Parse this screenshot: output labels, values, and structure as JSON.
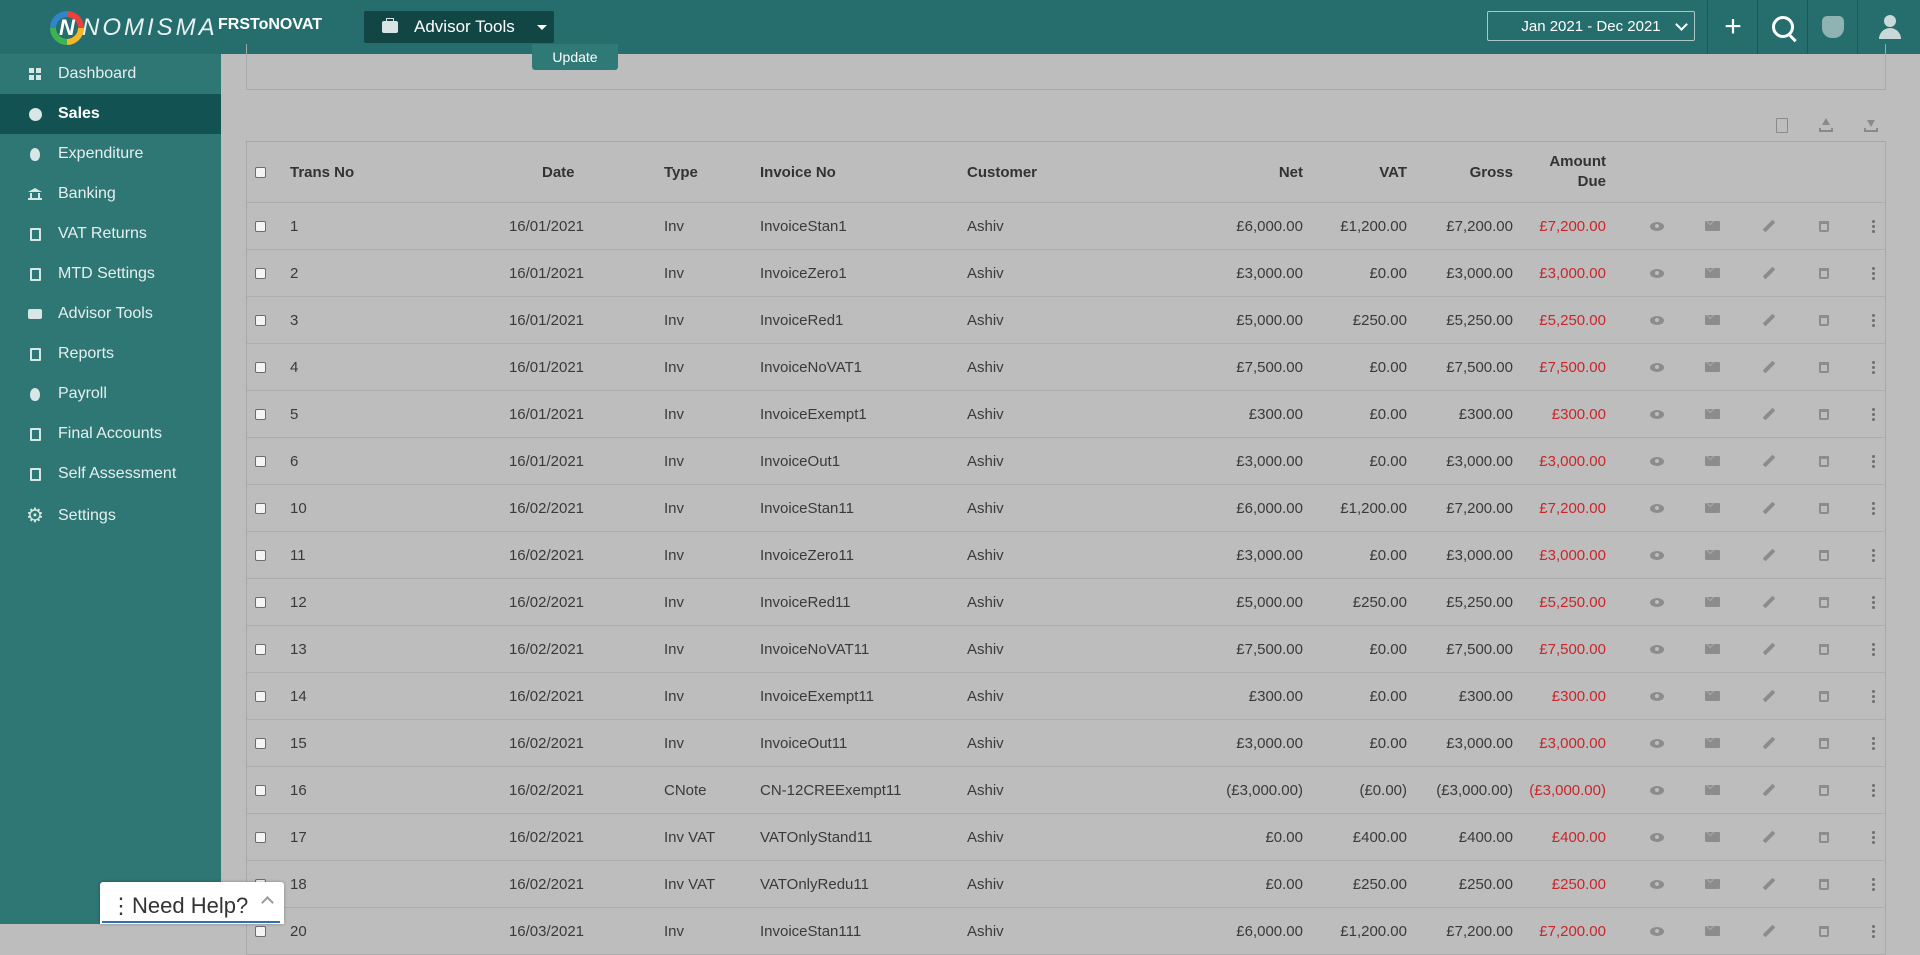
{
  "app": {
    "logo_text": "NOMISMA",
    "company": "FRSToNOVAT",
    "advisor_tools_label": "Advisor Tools",
    "period": "Jan 2021 - Dec 2021"
  },
  "sidebar": {
    "items": [
      {
        "label": "Dashboard",
        "icon": "dashboard-icon",
        "active": false
      },
      {
        "label": "Sales",
        "icon": "sales-icon",
        "active": true
      },
      {
        "label": "Expenditure",
        "icon": "expenditure-icon",
        "active": false
      },
      {
        "label": "Banking",
        "icon": "bank-icon",
        "active": false
      },
      {
        "label": "VAT Returns",
        "icon": "vat-returns-icon",
        "active": false
      },
      {
        "label": "MTD Settings",
        "icon": "mtd-settings-icon",
        "active": false
      },
      {
        "label": "Advisor Tools",
        "icon": "briefcase-icon",
        "active": false
      },
      {
        "label": "Reports",
        "icon": "reports-icon",
        "active": false
      },
      {
        "label": "Payroll",
        "icon": "payroll-icon",
        "active": false
      },
      {
        "label": "Final Accounts",
        "icon": "final-accounts-icon",
        "active": false
      },
      {
        "label": "Self Assessment",
        "icon": "self-assessment-icon",
        "active": false
      },
      {
        "label": "Settings",
        "icon": "gear-icon",
        "active": false
      }
    ]
  },
  "filter": {
    "update_label": "Update"
  },
  "table": {
    "headers": {
      "trans_no": "Trans No",
      "date": "Date",
      "type": "Type",
      "invoice_no": "Invoice No",
      "customer": "Customer",
      "net": "Net",
      "vat": "VAT",
      "gross": "Gross",
      "amount_due_line1": "Amount",
      "amount_due_line2": "Due"
    },
    "rows": [
      {
        "trans_no": "1",
        "date": "16/01/2021",
        "type": "Inv",
        "invoice_no": "InvoiceStan1",
        "customer": "Ashiv",
        "net": "£6,000.00",
        "vat": "£1,200.00",
        "gross": "£7,200.00",
        "due": "£7,200.00"
      },
      {
        "trans_no": "2",
        "date": "16/01/2021",
        "type": "Inv",
        "invoice_no": "InvoiceZero1",
        "customer": "Ashiv",
        "net": "£3,000.00",
        "vat": "£0.00",
        "gross": "£3,000.00",
        "due": "£3,000.00"
      },
      {
        "trans_no": "3",
        "date": "16/01/2021",
        "type": "Inv",
        "invoice_no": "InvoiceRed1",
        "customer": "Ashiv",
        "net": "£5,000.00",
        "vat": "£250.00",
        "gross": "£5,250.00",
        "due": "£5,250.00"
      },
      {
        "trans_no": "4",
        "date": "16/01/2021",
        "type": "Inv",
        "invoice_no": "InvoiceNoVAT1",
        "customer": "Ashiv",
        "net": "£7,500.00",
        "vat": "£0.00",
        "gross": "£7,500.00",
        "due": "£7,500.00"
      },
      {
        "trans_no": "5",
        "date": "16/01/2021",
        "type": "Inv",
        "invoice_no": "InvoiceExempt1",
        "customer": "Ashiv",
        "net": "£300.00",
        "vat": "£0.00",
        "gross": "£300.00",
        "due": "£300.00"
      },
      {
        "trans_no": "6",
        "date": "16/01/2021",
        "type": "Inv",
        "invoice_no": "InvoiceOut1",
        "customer": "Ashiv",
        "net": "£3,000.00",
        "vat": "£0.00",
        "gross": "£3,000.00",
        "due": "£3,000.00"
      },
      {
        "trans_no": "10",
        "date": "16/02/2021",
        "type": "Inv",
        "invoice_no": "InvoiceStan11",
        "customer": "Ashiv",
        "net": "£6,000.00",
        "vat": "£1,200.00",
        "gross": "£7,200.00",
        "due": "£7,200.00"
      },
      {
        "trans_no": "11",
        "date": "16/02/2021",
        "type": "Inv",
        "invoice_no": "InvoiceZero11",
        "customer": "Ashiv",
        "net": "£3,000.00",
        "vat": "£0.00",
        "gross": "£3,000.00",
        "due": "£3,000.00"
      },
      {
        "trans_no": "12",
        "date": "16/02/2021",
        "type": "Inv",
        "invoice_no": "InvoiceRed11",
        "customer": "Ashiv",
        "net": "£5,000.00",
        "vat": "£250.00",
        "gross": "£5,250.00",
        "due": "£5,250.00"
      },
      {
        "trans_no": "13",
        "date": "16/02/2021",
        "type": "Inv",
        "invoice_no": "InvoiceNoVAT11",
        "customer": "Ashiv",
        "net": "£7,500.00",
        "vat": "£0.00",
        "gross": "£7,500.00",
        "due": "£7,500.00"
      },
      {
        "trans_no": "14",
        "date": "16/02/2021",
        "type": "Inv",
        "invoice_no": "InvoiceExempt11",
        "customer": "Ashiv",
        "net": "£300.00",
        "vat": "£0.00",
        "gross": "£300.00",
        "due": "£300.00"
      },
      {
        "trans_no": "15",
        "date": "16/02/2021",
        "type": "Inv",
        "invoice_no": "InvoiceOut11",
        "customer": "Ashiv",
        "net": "£3,000.00",
        "vat": "£0.00",
        "gross": "£3,000.00",
        "due": "£3,000.00"
      },
      {
        "trans_no": "16",
        "date": "16/02/2021",
        "type": "CNote",
        "invoice_no": "CN-12CREExempt11",
        "customer": "Ashiv",
        "net": "(£3,000.00)",
        "vat": "(£0.00)",
        "gross": "(£3,000.00)",
        "due": "(£3,000.00)"
      },
      {
        "trans_no": "17",
        "date": "16/02/2021",
        "type": "Inv VAT",
        "invoice_no": "VATOnlyStand11",
        "customer": "Ashiv",
        "net": "£0.00",
        "vat": "£400.00",
        "gross": "£400.00",
        "due": "£400.00"
      },
      {
        "trans_no": "18",
        "date": "16/02/2021",
        "type": "Inv VAT",
        "invoice_no": "VATOnlyRedu11",
        "customer": "Ashiv",
        "net": "£0.00",
        "vat": "£250.00",
        "gross": "£250.00",
        "due": "£250.00"
      },
      {
        "trans_no": "20",
        "date": "16/03/2021",
        "type": "Inv",
        "invoice_no": "InvoiceStan111",
        "customer": "Ashiv",
        "net": "£6,000.00",
        "vat": "£1,200.00",
        "gross": "£7,200.00",
        "due": "£7,200.00"
      }
    ]
  },
  "help": {
    "label": "Need Help?"
  },
  "colors": {
    "topbar": "#256e6d",
    "sidebar": "#2f7775",
    "sidebar_active": "#135252",
    "amount_due": "#c9262b"
  }
}
